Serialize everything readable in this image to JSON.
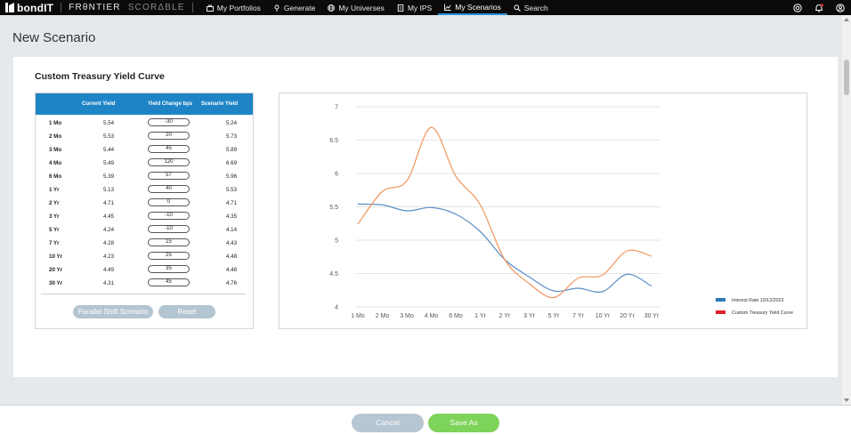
{
  "brand": {
    "name": "bondIT",
    "frontier": "FRθNTIER",
    "scorable": "SCORΔBLE"
  },
  "nav": {
    "items": [
      {
        "label": "My Portfolios",
        "icon": "briefcase-icon"
      },
      {
        "label": "Generate",
        "icon": "pin-icon"
      },
      {
        "label": "My Universes",
        "icon": "globe-icon"
      },
      {
        "label": "My IPS",
        "icon": "document-icon"
      },
      {
        "label": "My Scenarios",
        "icon": "chart-icon",
        "active": true
      },
      {
        "label": "Search",
        "icon": "search-icon"
      }
    ],
    "right_icons": [
      "support-icon",
      "notification-icon",
      "user-icon"
    ]
  },
  "page": {
    "title": "New Scenario",
    "section_title": "Custom Treasury Yield Curve"
  },
  "table": {
    "headers": {
      "current": "Current Yield",
      "change": "Yield Change bps",
      "scenario": "Scenario Yield"
    },
    "rows": [
      {
        "tenor": "1 Mo",
        "current": "5.54",
        "change": "-30",
        "scenario": "5.24"
      },
      {
        "tenor": "2 Mo",
        "current": "5.53",
        "change": "20",
        "scenario": "5.73"
      },
      {
        "tenor": "3 Mo",
        "current": "5.44",
        "change": "45",
        "scenario": "5.89"
      },
      {
        "tenor": "4 Mo",
        "current": "5.49",
        "change": "120",
        "scenario": "6.69"
      },
      {
        "tenor": "6 Mo",
        "current": "5.39",
        "change": "57",
        "scenario": "5.96"
      },
      {
        "tenor": "1 Yr",
        "current": "5.13",
        "change": "40",
        "scenario": "5.53"
      },
      {
        "tenor": "2 Yr",
        "current": "4.71",
        "change": "0",
        "scenario": "4.71"
      },
      {
        "tenor": "3 Yr",
        "current": "4.45",
        "change": "-10",
        "scenario": "4.35"
      },
      {
        "tenor": "5 Yr",
        "current": "4.24",
        "change": "-10",
        "scenario": "4.14"
      },
      {
        "tenor": "7 Yr",
        "current": "4.28",
        "change": "15",
        "scenario": "4.43"
      },
      {
        "tenor": "10 Yr",
        "current": "4.23",
        "change": "25",
        "scenario": "4.48"
      },
      {
        "tenor": "20 Yr",
        "current": "4.49",
        "change": "35",
        "scenario": "4.48"
      },
      {
        "tenor": "30 Yr",
        "current": "4.31",
        "change": "45",
        "scenario": "4.76"
      }
    ],
    "buttons": {
      "parallel": "Parallel Shift Scenario",
      "reset": "Reset"
    }
  },
  "chart_data": {
    "type": "line",
    "categories": [
      "1 Mo",
      "2 Mo",
      "3 Mo",
      "4 Mo",
      "6 Mo",
      "1 Yr",
      "2 Yr",
      "3 Yr",
      "5 Yr",
      "7 Yr",
      "10 Yr",
      "20 Yr",
      "30 Yr"
    ],
    "series": [
      {
        "name": "Interest Rate 10/12/2023",
        "color": "#5b8fc7",
        "legend_color": "#2a7ab8",
        "values": [
          5.54,
          5.53,
          5.44,
          5.49,
          5.39,
          5.13,
          4.71,
          4.45,
          4.24,
          4.28,
          4.23,
          4.49,
          4.31
        ]
      },
      {
        "name": "Custom Treasury Yield Curve",
        "color": "#f0955c",
        "legend_color": "#e0222a",
        "values": [
          5.24,
          5.73,
          5.89,
          6.69,
          5.96,
          5.53,
          4.71,
          4.35,
          4.14,
          4.43,
          4.48,
          4.84,
          4.76
        ]
      }
    ],
    "ylim": [
      4,
      7
    ],
    "yticks": [
      "4",
      "4.5",
      "5",
      "5.5",
      "6",
      "6.5",
      "7"
    ],
    "grid": true,
    "legend": "bottom-right"
  },
  "footer": {
    "cancel": "Cancel",
    "save": "Save As"
  }
}
